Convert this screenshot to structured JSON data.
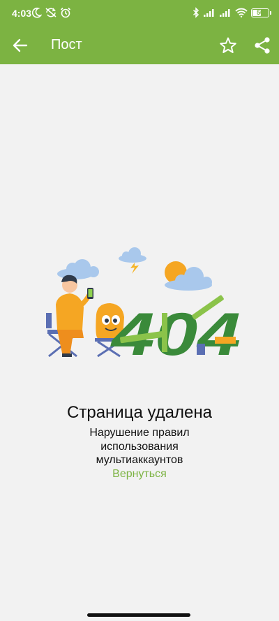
{
  "status_bar": {
    "time": "4:03",
    "battery_level": "50",
    "battery_fraction": 0.5,
    "left_icons": [
      "moon-icon",
      "sync-off-icon",
      "alarm-icon"
    ],
    "right_icons": [
      "bluetooth-icon",
      "signal-icon",
      "signal-icon",
      "wifi-icon",
      "battery-icon"
    ]
  },
  "app_bar": {
    "title": "Пост",
    "back_icon": "arrow-left-icon",
    "actions": [
      "star-icon",
      "share-icon"
    ]
  },
  "error_page": {
    "code_text": "404",
    "title": "Страница удалена",
    "description": "Нарушение правил использования мультиаккаунтов",
    "back_link": "Вернуться"
  },
  "colors": {
    "brand": "#7cb342",
    "background": "#f2f2f2",
    "text": "#111111"
  }
}
